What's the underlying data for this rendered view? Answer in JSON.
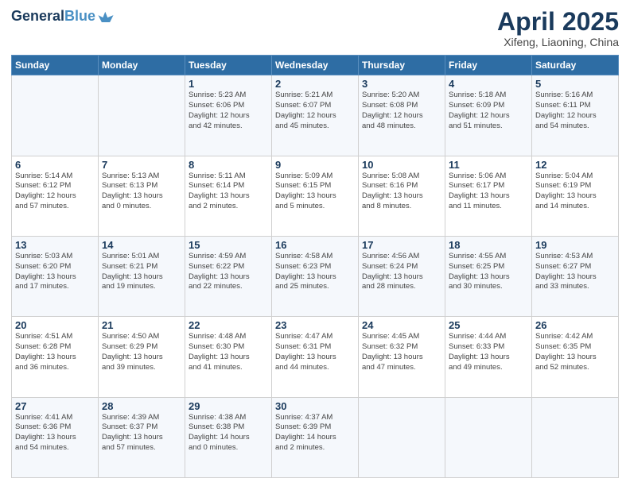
{
  "header": {
    "logo_line1": "General",
    "logo_line2": "Blue",
    "title": "April 2025",
    "subtitle": "Xifeng, Liaoning, China"
  },
  "calendar": {
    "weekdays": [
      "Sunday",
      "Monday",
      "Tuesday",
      "Wednesday",
      "Thursday",
      "Friday",
      "Saturday"
    ],
    "weeks": [
      [
        {
          "day": "",
          "info": ""
        },
        {
          "day": "",
          "info": ""
        },
        {
          "day": "1",
          "info": "Sunrise: 5:23 AM\nSunset: 6:06 PM\nDaylight: 12 hours\nand 42 minutes."
        },
        {
          "day": "2",
          "info": "Sunrise: 5:21 AM\nSunset: 6:07 PM\nDaylight: 12 hours\nand 45 minutes."
        },
        {
          "day": "3",
          "info": "Sunrise: 5:20 AM\nSunset: 6:08 PM\nDaylight: 12 hours\nand 48 minutes."
        },
        {
          "day": "4",
          "info": "Sunrise: 5:18 AM\nSunset: 6:09 PM\nDaylight: 12 hours\nand 51 minutes."
        },
        {
          "day": "5",
          "info": "Sunrise: 5:16 AM\nSunset: 6:11 PM\nDaylight: 12 hours\nand 54 minutes."
        }
      ],
      [
        {
          "day": "6",
          "info": "Sunrise: 5:14 AM\nSunset: 6:12 PM\nDaylight: 12 hours\nand 57 minutes."
        },
        {
          "day": "7",
          "info": "Sunrise: 5:13 AM\nSunset: 6:13 PM\nDaylight: 13 hours\nand 0 minutes."
        },
        {
          "day": "8",
          "info": "Sunrise: 5:11 AM\nSunset: 6:14 PM\nDaylight: 13 hours\nand 2 minutes."
        },
        {
          "day": "9",
          "info": "Sunrise: 5:09 AM\nSunset: 6:15 PM\nDaylight: 13 hours\nand 5 minutes."
        },
        {
          "day": "10",
          "info": "Sunrise: 5:08 AM\nSunset: 6:16 PM\nDaylight: 13 hours\nand 8 minutes."
        },
        {
          "day": "11",
          "info": "Sunrise: 5:06 AM\nSunset: 6:17 PM\nDaylight: 13 hours\nand 11 minutes."
        },
        {
          "day": "12",
          "info": "Sunrise: 5:04 AM\nSunset: 6:19 PM\nDaylight: 13 hours\nand 14 minutes."
        }
      ],
      [
        {
          "day": "13",
          "info": "Sunrise: 5:03 AM\nSunset: 6:20 PM\nDaylight: 13 hours\nand 17 minutes."
        },
        {
          "day": "14",
          "info": "Sunrise: 5:01 AM\nSunset: 6:21 PM\nDaylight: 13 hours\nand 19 minutes."
        },
        {
          "day": "15",
          "info": "Sunrise: 4:59 AM\nSunset: 6:22 PM\nDaylight: 13 hours\nand 22 minutes."
        },
        {
          "day": "16",
          "info": "Sunrise: 4:58 AM\nSunset: 6:23 PM\nDaylight: 13 hours\nand 25 minutes."
        },
        {
          "day": "17",
          "info": "Sunrise: 4:56 AM\nSunset: 6:24 PM\nDaylight: 13 hours\nand 28 minutes."
        },
        {
          "day": "18",
          "info": "Sunrise: 4:55 AM\nSunset: 6:25 PM\nDaylight: 13 hours\nand 30 minutes."
        },
        {
          "day": "19",
          "info": "Sunrise: 4:53 AM\nSunset: 6:27 PM\nDaylight: 13 hours\nand 33 minutes."
        }
      ],
      [
        {
          "day": "20",
          "info": "Sunrise: 4:51 AM\nSunset: 6:28 PM\nDaylight: 13 hours\nand 36 minutes."
        },
        {
          "day": "21",
          "info": "Sunrise: 4:50 AM\nSunset: 6:29 PM\nDaylight: 13 hours\nand 39 minutes."
        },
        {
          "day": "22",
          "info": "Sunrise: 4:48 AM\nSunset: 6:30 PM\nDaylight: 13 hours\nand 41 minutes."
        },
        {
          "day": "23",
          "info": "Sunrise: 4:47 AM\nSunset: 6:31 PM\nDaylight: 13 hours\nand 44 minutes."
        },
        {
          "day": "24",
          "info": "Sunrise: 4:45 AM\nSunset: 6:32 PM\nDaylight: 13 hours\nand 47 minutes."
        },
        {
          "day": "25",
          "info": "Sunrise: 4:44 AM\nSunset: 6:33 PM\nDaylight: 13 hours\nand 49 minutes."
        },
        {
          "day": "26",
          "info": "Sunrise: 4:42 AM\nSunset: 6:35 PM\nDaylight: 13 hours\nand 52 minutes."
        }
      ],
      [
        {
          "day": "27",
          "info": "Sunrise: 4:41 AM\nSunset: 6:36 PM\nDaylight: 13 hours\nand 54 minutes."
        },
        {
          "day": "28",
          "info": "Sunrise: 4:39 AM\nSunset: 6:37 PM\nDaylight: 13 hours\nand 57 minutes."
        },
        {
          "day": "29",
          "info": "Sunrise: 4:38 AM\nSunset: 6:38 PM\nDaylight: 14 hours\nand 0 minutes."
        },
        {
          "day": "30",
          "info": "Sunrise: 4:37 AM\nSunset: 6:39 PM\nDaylight: 14 hours\nand 2 minutes."
        },
        {
          "day": "",
          "info": ""
        },
        {
          "day": "",
          "info": ""
        },
        {
          "day": "",
          "info": ""
        }
      ]
    ]
  }
}
